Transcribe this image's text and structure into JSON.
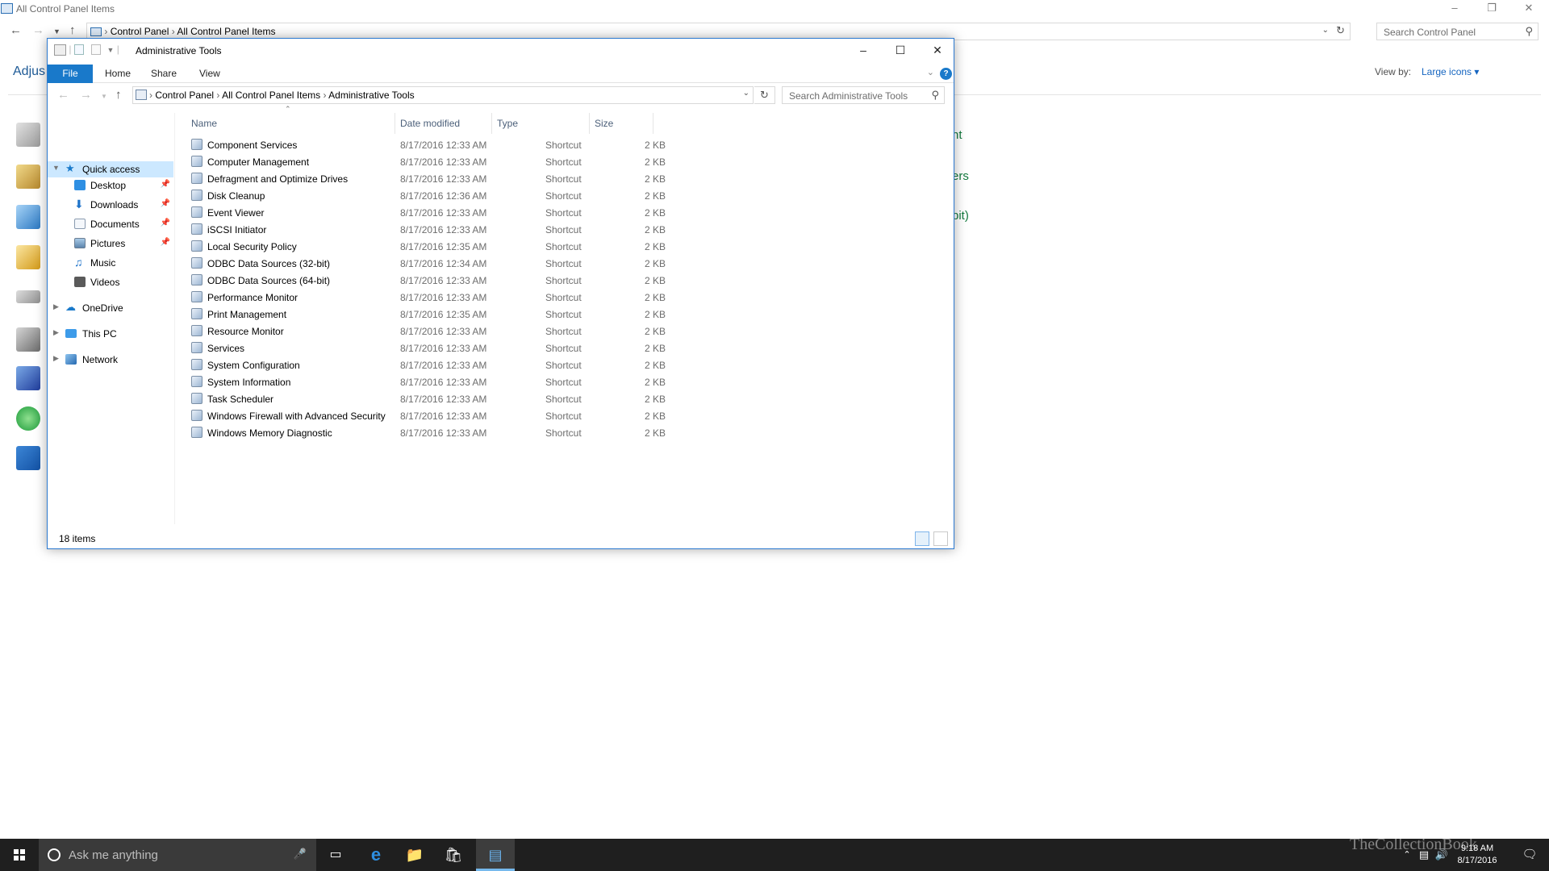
{
  "background_window": {
    "title": "All Control Panel Items",
    "breadcrumbs": [
      "Control Panel",
      "All Control Panel Items"
    ],
    "search_placeholder": "Search Control Panel",
    "heading_partial": "Adjus",
    "view_by_label": "View by:",
    "view_by_value": "Large icons",
    "partial_links": [
      "nt",
      "ers",
      "bit)"
    ]
  },
  "explorer": {
    "title": "Administrative Tools",
    "ribbon_tabs": [
      "File",
      "Home",
      "Share",
      "View"
    ],
    "breadcrumbs": [
      "Control Panel",
      "All Control Panel Items",
      "Administrative Tools"
    ],
    "search_placeholder": "Search Administrative Tools",
    "nav": {
      "quick_access": "Quick access",
      "pinned": [
        "Desktop",
        "Downloads",
        "Documents",
        "Pictures",
        "Music",
        "Videos"
      ],
      "onedrive": "OneDrive",
      "this_pc": "This PC",
      "network": "Network"
    },
    "columns": [
      "Name",
      "Date modified",
      "Type",
      "Size"
    ],
    "files": [
      {
        "name": "Component Services",
        "date": "8/17/2016 12:33 AM",
        "type": "Shortcut",
        "size": "2 KB"
      },
      {
        "name": "Computer Management",
        "date": "8/17/2016 12:33 AM",
        "type": "Shortcut",
        "size": "2 KB"
      },
      {
        "name": "Defragment and Optimize Drives",
        "date": "8/17/2016 12:33 AM",
        "type": "Shortcut",
        "size": "2 KB"
      },
      {
        "name": "Disk Cleanup",
        "date": "8/17/2016 12:36 AM",
        "type": "Shortcut",
        "size": "2 KB"
      },
      {
        "name": "Event Viewer",
        "date": "8/17/2016 12:33 AM",
        "type": "Shortcut",
        "size": "2 KB"
      },
      {
        "name": "iSCSI Initiator",
        "date": "8/17/2016 12:33 AM",
        "type": "Shortcut",
        "size": "2 KB"
      },
      {
        "name": "Local Security Policy",
        "date": "8/17/2016 12:35 AM",
        "type": "Shortcut",
        "size": "2 KB"
      },
      {
        "name": "ODBC Data Sources (32-bit)",
        "date": "8/17/2016 12:34 AM",
        "type": "Shortcut",
        "size": "2 KB"
      },
      {
        "name": "ODBC Data Sources (64-bit)",
        "date": "8/17/2016 12:33 AM",
        "type": "Shortcut",
        "size": "2 KB"
      },
      {
        "name": "Performance Monitor",
        "date": "8/17/2016 12:33 AM",
        "type": "Shortcut",
        "size": "2 KB"
      },
      {
        "name": "Print Management",
        "date": "8/17/2016 12:35 AM",
        "type": "Shortcut",
        "size": "2 KB"
      },
      {
        "name": "Resource Monitor",
        "date": "8/17/2016 12:33 AM",
        "type": "Shortcut",
        "size": "2 KB"
      },
      {
        "name": "Services",
        "date": "8/17/2016 12:33 AM",
        "type": "Shortcut",
        "size": "2 KB"
      },
      {
        "name": "System Configuration",
        "date": "8/17/2016 12:33 AM",
        "type": "Shortcut",
        "size": "2 KB"
      },
      {
        "name": "System Information",
        "date": "8/17/2016 12:33 AM",
        "type": "Shortcut",
        "size": "2 KB"
      },
      {
        "name": "Task Scheduler",
        "date": "8/17/2016 12:33 AM",
        "type": "Shortcut",
        "size": "2 KB"
      },
      {
        "name": "Windows Firewall with Advanced Security",
        "date": "8/17/2016 12:33 AM",
        "type": "Shortcut",
        "size": "2 KB"
      },
      {
        "name": "Windows Memory Diagnostic",
        "date": "8/17/2016 12:33 AM",
        "type": "Shortcut",
        "size": "2 KB"
      }
    ],
    "status": "18 items"
  },
  "taskbar": {
    "search_placeholder": "Ask me anything",
    "time": "9:18 AM",
    "date": "8/17/2016",
    "watermark": "TheCollectionBook"
  },
  "colors": {
    "accent": "#1979ca",
    "selection": "#cce8ff",
    "link_green": "#137a3e",
    "taskbar": "#1f1f1f"
  }
}
